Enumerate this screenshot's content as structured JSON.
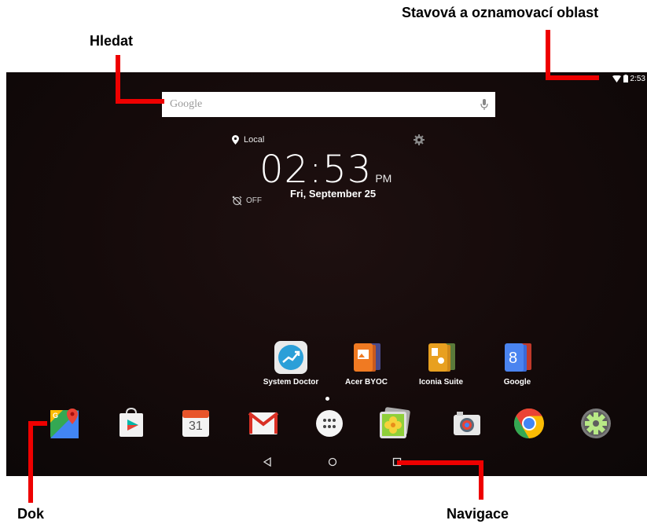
{
  "callouts": {
    "status_area": "Stavová a oznamovací oblast",
    "search": "Hledat",
    "dock": "Dok",
    "navigation": "Navigace"
  },
  "statusbar": {
    "time": "2:53",
    "icons": [
      "wifi-icon",
      "battery-icon"
    ]
  },
  "search": {
    "placeholder": "Google",
    "icon": "mic-icon"
  },
  "clock_widget": {
    "location": "Local",
    "time": "02:53",
    "ampm": "PM",
    "date": "Fri, September 25",
    "alarm_status": "OFF"
  },
  "apps": [
    {
      "label": "System Doctor",
      "icon": "system-doctor-icon"
    },
    {
      "label": "Acer BYOC",
      "icon": "acer-byoc-icon"
    },
    {
      "label": "Iconia Suite",
      "icon": "iconia-suite-icon"
    },
    {
      "label": "Google",
      "icon": "google-folder-icon"
    }
  ],
  "dock": [
    {
      "icon": "maps-icon"
    },
    {
      "icon": "play-store-icon"
    },
    {
      "icon": "calendar-icon",
      "text": "31"
    },
    {
      "icon": "gmail-icon"
    },
    {
      "icon": "app-drawer-icon"
    },
    {
      "icon": "gallery-icon"
    },
    {
      "icon": "camera-icon"
    },
    {
      "icon": "chrome-icon"
    },
    {
      "icon": "settings-icon"
    }
  ],
  "navigation": [
    "back-icon",
    "home-icon",
    "recents-icon"
  ],
  "colors": {
    "callout_line": "#ee0000",
    "wallpaper": "#140a0a"
  }
}
